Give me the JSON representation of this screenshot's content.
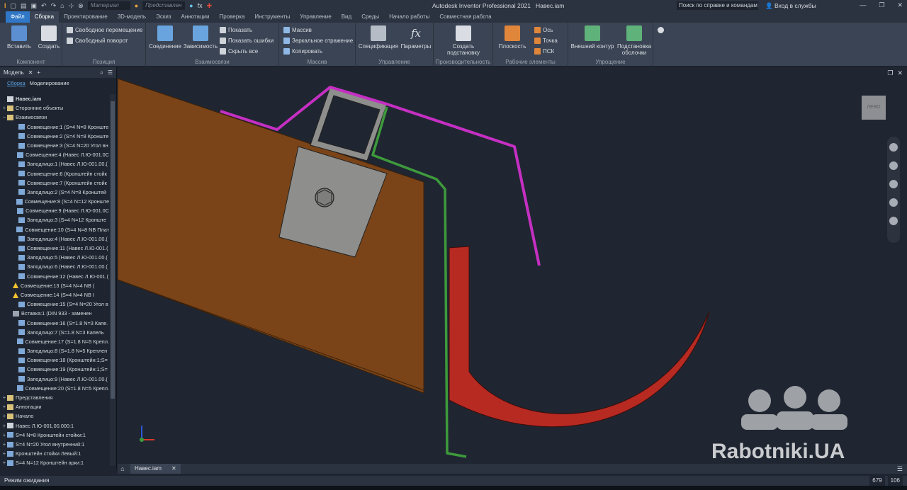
{
  "titlebar": {
    "material_placeholder": "Материал",
    "appearance_placeholder": "Представлен",
    "app_title": "Autodesk Inventor Professional 2021",
    "doc_title": "Навес.iam",
    "help_search": "Поиск по справке и командам",
    "signin": "Вход в службы"
  },
  "menu": {
    "file": "Файл",
    "tabs": [
      "Сборка",
      "Проектирование",
      "3D-модель",
      "Эскиз",
      "Аннотации",
      "Проверка",
      "Инструменты",
      "Управление",
      "Вид",
      "Среды",
      "Начало работы",
      "Совместная работа"
    ]
  },
  "ribbon": {
    "component": {
      "title": "Компонент",
      "insert": "Вставить",
      "create": "Создать"
    },
    "position": {
      "title": "Позиция",
      "free_move": "Свободное перемещение",
      "free_rotate": "Свободный поворот"
    },
    "relationships": {
      "title": "Взаимосвязи",
      "joint": "Соединение",
      "constrain": "Зависимость",
      "show": "Показать",
      "show_errors": "Показать ошибки",
      "hide_all": "Скрыть все"
    },
    "pattern": {
      "title": "Массив",
      "pattern": "Массив",
      "mirror": "Зеркальное отражение",
      "copy": "Копировать"
    },
    "manage": {
      "title": "Управление",
      "bom": "Спецификация",
      "parameters": "Параметры"
    },
    "productivity": {
      "title": "Производительность",
      "create_substitute_1": "Создать",
      "create_substitute_2": "подстановку"
    },
    "work_features": {
      "title": "Рабочие элементы",
      "plane": "Плоскость",
      "axis": "Ось",
      "point": "Точка",
      "ucs": "ПСК"
    },
    "simplification": {
      "title": "Упрощение",
      "shrinkwrap": "Внешний контур",
      "substitute_1": "Подстановка",
      "substitute_2": "оболочки"
    }
  },
  "browser": {
    "title": "Модель",
    "tab_assembly": "Сборка",
    "tab_modeling": "Моделирование",
    "nodes": [
      {
        "text": "Навес.iam",
        "level": 0,
        "exp": "",
        "icon": "assembly"
      },
      {
        "text": "Сторонние объекты",
        "level": 0,
        "exp": "+",
        "icon": "folder"
      },
      {
        "text": "Взаимосвязи",
        "level": 0,
        "exp": "−",
        "icon": "folder"
      },
      {
        "text": "Совмещение:1 (S=4 N=8 Кронште",
        "level": 2,
        "exp": "",
        "icon": "constraint"
      },
      {
        "text": "Совмещение:2 (S=4 N=8 Кронште",
        "level": 2,
        "exp": "",
        "icon": "constraint"
      },
      {
        "text": "Совмещение:3 (S=4 N=20 Угол вн",
        "level": 2,
        "exp": "",
        "icon": "constraint"
      },
      {
        "text": "Совмещение:4 (Навес Л.Ю-001.0С",
        "level": 2,
        "exp": "",
        "icon": "constraint"
      },
      {
        "text": "Заподлицо:1 (Навес Л.Ю-001.00.(",
        "level": 2,
        "exp": "",
        "icon": "constraint"
      },
      {
        "text": "Совмещение:6 (Кронштейн стойк",
        "level": 2,
        "exp": "",
        "icon": "constraint"
      },
      {
        "text": "Совмещение:7 (Кронштейн стойк",
        "level": 2,
        "exp": "",
        "icon": "constraint"
      },
      {
        "text": "Заподлицо:2 (S=4 N=8 Кронштей",
        "level": 2,
        "exp": "",
        "icon": "constraint"
      },
      {
        "text": "Совмещение:8 (S=4 N=12 Кронште",
        "level": 2,
        "exp": "",
        "icon": "constraint"
      },
      {
        "text": "Совмещение:9 (Навес Л.Ю-001.0С",
        "level": 2,
        "exp": "",
        "icon": "constraint"
      },
      {
        "text": "Заподлицо:3 (S=4 N=12 Кронште",
        "level": 2,
        "exp": "",
        "icon": "constraint"
      },
      {
        "text": "Совмещение:10 (S=4 N=8 NB Плат",
        "level": 2,
        "exp": "",
        "icon": "constraint"
      },
      {
        "text": "Заподлицо:4 (Навес Л.Ю-001.00.(",
        "level": 2,
        "exp": "",
        "icon": "constraint"
      },
      {
        "text": "Совмещение:11 (Навес Л.Ю-001.(",
        "level": 2,
        "exp": "",
        "icon": "constraint"
      },
      {
        "text": "Заподлицо:5 (Навес Л.Ю-001.00.(",
        "level": 2,
        "exp": "",
        "icon": "constraint"
      },
      {
        "text": "Заподлицо:6 (Навес Л.Ю-001.00.(",
        "level": 2,
        "exp": "",
        "icon": "constraint"
      },
      {
        "text": "Совмещение:12 (Навес Л.Ю-001.(",
        "level": 2,
        "exp": "",
        "icon": "constraint"
      },
      {
        "text": "Совмещение:13 (S=4 N=4 NB (",
        "level": 1,
        "exp": "",
        "icon": "warning"
      },
      {
        "text": "Совмещение:14 (S=4 N=4 NB I",
        "level": 1,
        "exp": "",
        "icon": "warning"
      },
      {
        "text": "Совмещение:15 (S=4 N=20 Угол в",
        "level": 2,
        "exp": "",
        "icon": "constraint"
      },
      {
        "text": "Вставка:1 (DIN 933 - заменен",
        "level": 1,
        "exp": "",
        "icon": "insert"
      },
      {
        "text": "Совмещение:16 (S=1.8 N=3 Капе.",
        "level": 2,
        "exp": "",
        "icon": "constraint"
      },
      {
        "text": "Заподлицо:7 (S=1.8 N=3 Капель",
        "level": 2,
        "exp": "",
        "icon": "constraint"
      },
      {
        "text": "Совмещение:17 (S=1.8 N=5 Крепл.",
        "level": 2,
        "exp": "",
        "icon": "constraint"
      },
      {
        "text": "Заподлицо:8 (S=1.8 N=5 Креплен",
        "level": 2,
        "exp": "",
        "icon": "constraint"
      },
      {
        "text": "Совмещение:18 (Кронштейн:1;S=",
        "level": 2,
        "exp": "",
        "icon": "constraint"
      },
      {
        "text": "Совмещение:19 (Кронштейн:1;S=",
        "level": 2,
        "exp": "",
        "icon": "constraint"
      },
      {
        "text": "Заподлицо:9 (Навес Л.Ю-001.00.(",
        "level": 2,
        "exp": "",
        "icon": "constraint"
      },
      {
        "text": "Совмещение:20 (S=1.8 N=5 Крепл.",
        "level": 2,
        "exp": "",
        "icon": "constraint"
      },
      {
        "text": "Представления",
        "level": 0,
        "exp": "+",
        "icon": "folder"
      },
      {
        "text": "Аннотации",
        "level": 0,
        "exp": "+",
        "icon": "folder"
      },
      {
        "text": "Начало",
        "level": 0,
        "exp": "+",
        "icon": "folder"
      },
      {
        "text": "Навес Л.Ю-001.00.000:1",
        "level": 0,
        "exp": "+",
        "icon": "assembly"
      },
      {
        "text": "S=4 N=8 Кронштейн стойки:1",
        "level": 0,
        "exp": "+",
        "icon": "part"
      },
      {
        "text": "S=4 N=20 Угол внутренний:1",
        "level": 0,
        "exp": "+",
        "icon": "part"
      },
      {
        "text": "Кронштейн стойки Левый:1",
        "level": 0,
        "exp": "+",
        "icon": "part"
      },
      {
        "text": "S=4 N=12 Кронштейн арки:1",
        "level": 0,
        "exp": "+",
        "icon": "part"
      }
    ]
  },
  "viewport": {
    "viewcube_label": "ЛЕВО",
    "watermark": "Rabotniki.UA",
    "colors": {
      "beam": "#7a4418",
      "bracket": "#8e8e8c",
      "gutter": "#b72a22",
      "magenta_profile": "#c52fc2",
      "green_profile": "#3e9a3c"
    }
  },
  "doctabs": {
    "active": "Навес.iam"
  },
  "status": {
    "text": "Режим ожидания",
    "n1": "679",
    "n2": "106"
  }
}
